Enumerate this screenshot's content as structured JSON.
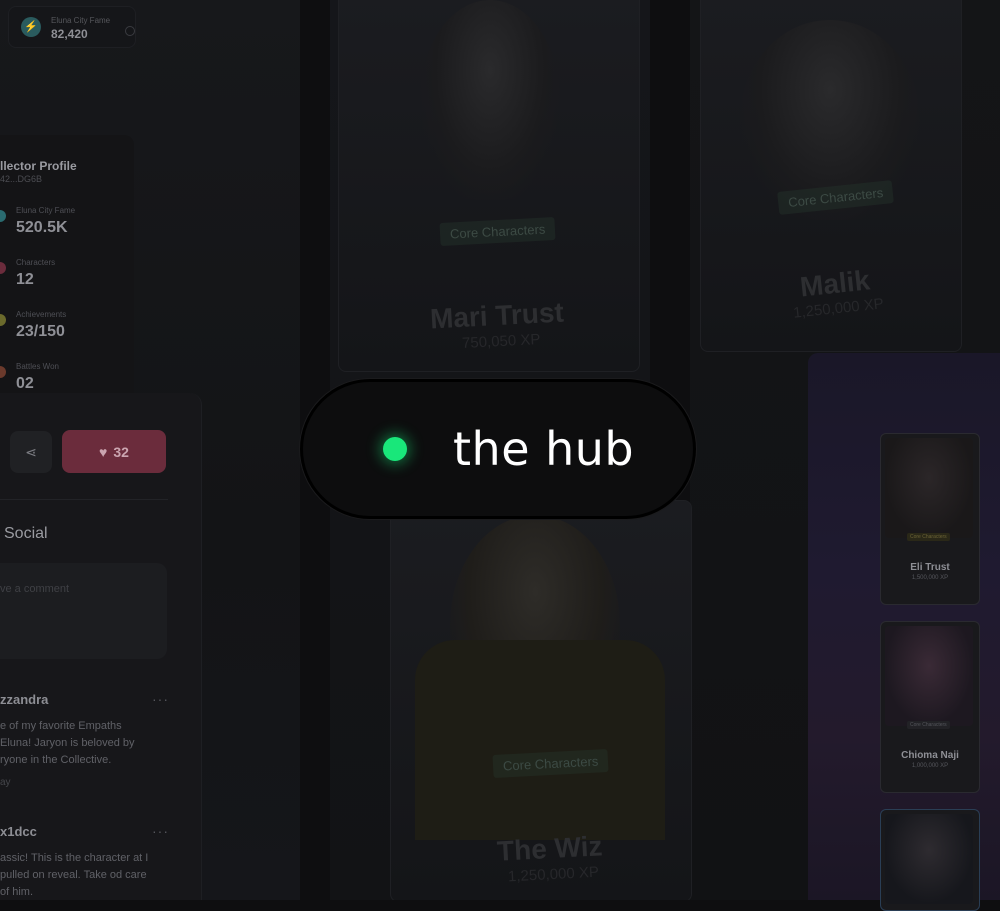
{
  "top_fame": {
    "label": "Eluna City Fame",
    "value": "82,420",
    "icon": "lightning-icon"
  },
  "collector": {
    "title": "llector Profile",
    "subtitle": "42...DG6B",
    "stats": [
      {
        "label": "Eluna City Fame",
        "value": "520.5K",
        "color": "#2a6b70"
      },
      {
        "label": "Characters",
        "value": "12",
        "color": "#6b2c3c"
      },
      {
        "label": "Achievements",
        "value": "23/150",
        "color": "#6b6a2c"
      },
      {
        "label": "Battles Won",
        "value": "02",
        "color": "#6b3a2c"
      }
    ]
  },
  "social_panel": {
    "share_icon": "share-icon",
    "like_count": "32",
    "like_icon": "heart-icon",
    "section_title": "Social",
    "comment_placeholder": "ve a comment",
    "comments": [
      {
        "user": "zzandra",
        "more": "···",
        "text": "e of my favorite Empaths Eluna! Jaryon is beloved by ryone  in the Collective.",
        "time": "ay"
      },
      {
        "user": "x1dcc",
        "more": "···",
        "text": "assic! This is the character at I pulled on reveal. Take od care of him.",
        "time": ""
      }
    ]
  },
  "background_characters": [
    {
      "tag": "Core Characters",
      "name": "Mari Trust",
      "xp": "750,050 XP"
    },
    {
      "tag": "Core Characters",
      "name": "Malik",
      "xp": "1,250,000 XP"
    },
    {
      "tag": "Core Characters",
      "name": "The Wiz",
      "xp": "1,250,000 XP"
    }
  ],
  "gallery": [
    {
      "tag": "Core Characters",
      "name": "Eli Trust",
      "xp": "1,500,000 XP"
    },
    {
      "tag": "Core Characters",
      "name": "Chioma Naji",
      "xp": "1,000,000 XP"
    },
    {
      "tag": "",
      "name": "",
      "xp": ""
    }
  ],
  "overlay": {
    "label": "the hub",
    "status_color": "#19e77a"
  },
  "colors": {
    "accent_green": "#19e77a",
    "like_red": "#6b2c3c"
  }
}
